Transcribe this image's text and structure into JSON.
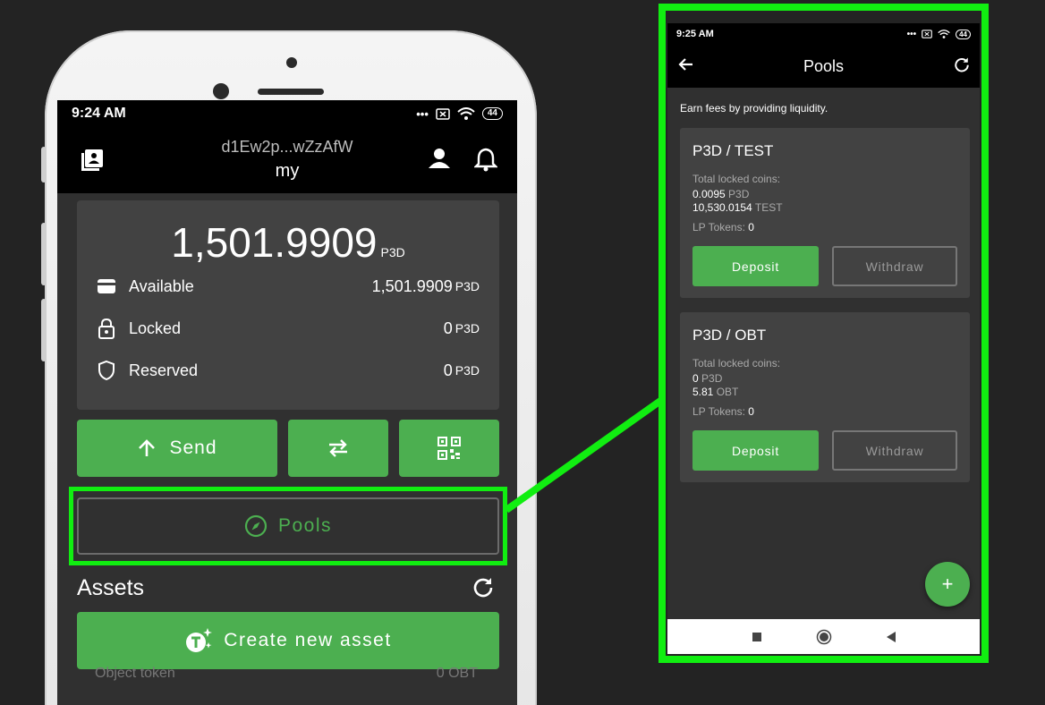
{
  "wallet": {
    "status": {
      "time": "9:24 AM",
      "battery": "44"
    },
    "header": {
      "address": "d1Ew2p...wZzAfW",
      "wallet_name": "my"
    },
    "balance": {
      "total": "1,501.9909",
      "unit": "P3D",
      "rows": [
        {
          "label": "Available",
          "value": "1,501.9909",
          "unit": "P3D",
          "icon": "wallet-icon"
        },
        {
          "label": "Locked",
          "value": "0",
          "unit": "P3D",
          "icon": "lock-icon"
        },
        {
          "label": "Reserved",
          "value": "0",
          "unit": "P3D",
          "icon": "shield-icon"
        }
      ]
    },
    "actions": {
      "send_label": "Send",
      "pools_label": "Pools"
    },
    "assets": {
      "title": "Assets",
      "create_label": "Create new asset",
      "peek_name": "Object token",
      "peek_value": "0 OBT"
    }
  },
  "pools_screen": {
    "status": {
      "time": "9:25 AM",
      "battery": "44"
    },
    "title": "Pools",
    "subtitle": "Earn fees by providing liquidity.",
    "pools": [
      {
        "name": "P3D / TEST",
        "locked_label": "Total locked coins:",
        "amount1": "0.0095",
        "unit1": "P3D",
        "amount2": "10,530.0154",
        "unit2": "TEST",
        "lp_label": "LP Tokens:",
        "lp_value": "0",
        "deposit_label": "Deposit",
        "withdraw_label": "Withdraw"
      },
      {
        "name": "P3D / OBT",
        "locked_label": "Total locked coins:",
        "amount1": "0",
        "unit1": "P3D",
        "amount2": "5.81",
        "unit2": "OBT",
        "lp_label": "LP Tokens:",
        "lp_value": "0",
        "deposit_label": "Deposit",
        "withdraw_label": "Withdraw"
      }
    ],
    "fab_label": "+"
  },
  "colors": {
    "accent": "#4caf50",
    "highlight": "#11ee11",
    "card": "#424242",
    "background": "#303030"
  }
}
